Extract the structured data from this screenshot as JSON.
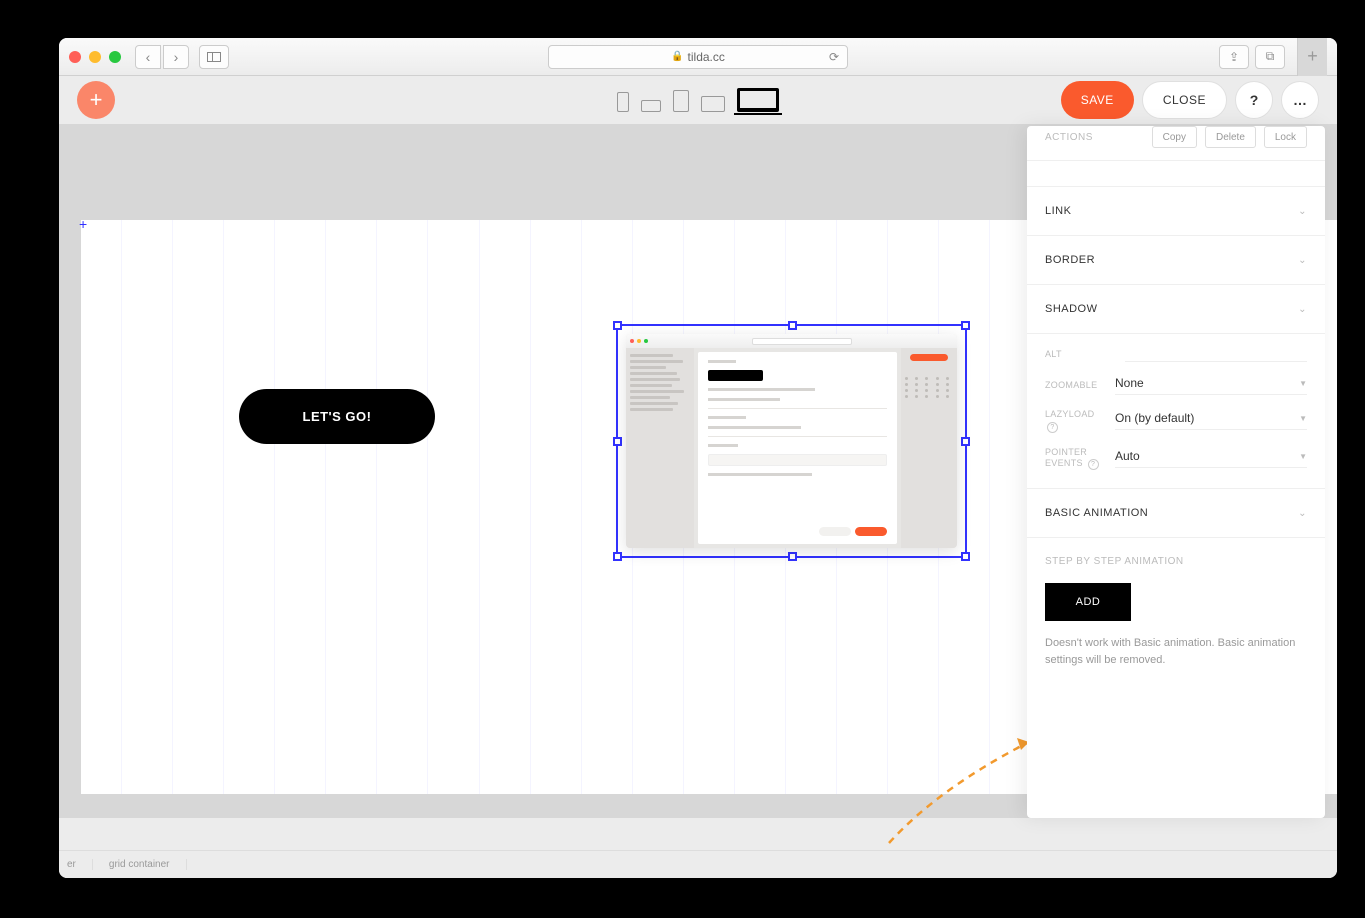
{
  "browser": {
    "url_host": "tilda.cc"
  },
  "toolbar": {
    "save": "SAVE",
    "close": "CLOSE",
    "help": "?",
    "more": "…"
  },
  "canvas": {
    "button_label": "LET'S GO!"
  },
  "panel": {
    "actions_label": "ACTIONS",
    "actions": {
      "copy": "Copy",
      "delete": "Delete",
      "lock": "Lock"
    },
    "sections": {
      "link": "LINK",
      "border": "BORDER",
      "shadow": "SHADOW",
      "basic_animation": "BASIC ANIMATION"
    },
    "alt_label": "ALT",
    "zoomable": {
      "label": "ZOOMABLE",
      "value": "None"
    },
    "lazyload": {
      "label": "LAZYLOAD",
      "value": "On (by default)"
    },
    "pointer": {
      "label": "POINTER EVENTS",
      "value": "Auto"
    },
    "step": {
      "title": "STEP BY STEP ANIMATION",
      "add": "ADD",
      "note": "Doesn't work with Basic animation. Basic animation settings will be removed."
    }
  },
  "status": {
    "left": "er",
    "grid": "grid container"
  }
}
